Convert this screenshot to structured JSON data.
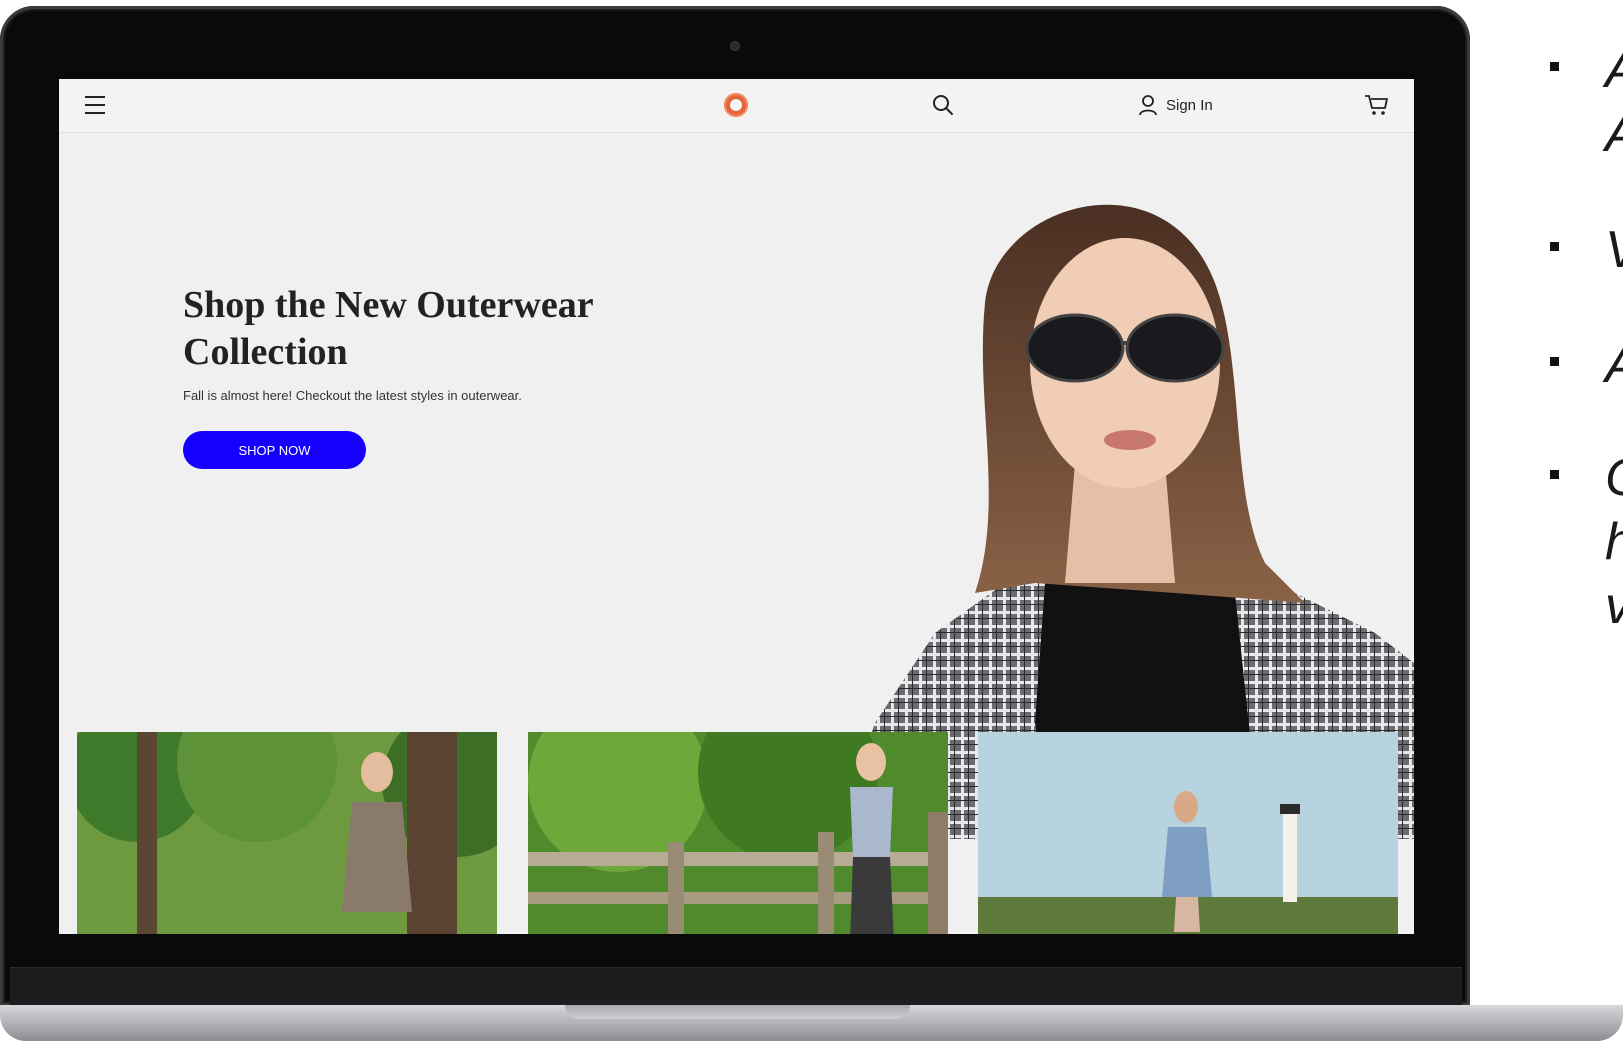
{
  "navbar": {
    "signin_label": "Sign In",
    "icons": [
      "menu-icon",
      "logo-icon",
      "search-icon",
      "user-icon",
      "cart-icon"
    ]
  },
  "hero": {
    "title": "Shop the New Outerwear Collection",
    "subtitle": "Fall is almost here! Checkout the latest styles in outerwear.",
    "cta_label": "SHOP NOW"
  },
  "bullets": [
    {
      "lines": [
        "A",
        "A"
      ]
    },
    {
      "lines": [
        "V"
      ]
    },
    {
      "lines": [
        "A"
      ]
    },
    {
      "lines": [
        "C",
        "h",
        "v"
      ]
    }
  ],
  "colors": {
    "cta": "#1500ff",
    "logo": "#e5643c",
    "hero_bg": "#f0f0f0",
    "text": "#222222"
  }
}
